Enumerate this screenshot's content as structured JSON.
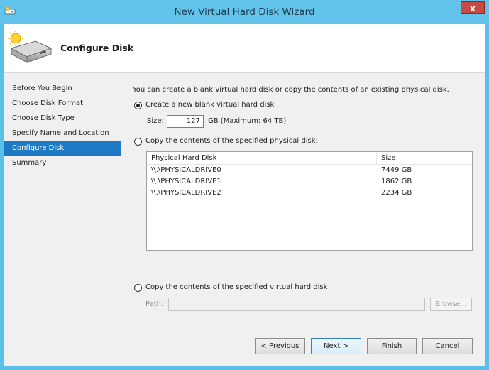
{
  "window": {
    "title": "New Virtual Hard Disk Wizard",
    "close_glyph": "x"
  },
  "header": {
    "heading": "Configure Disk"
  },
  "steps": [
    {
      "label": "Before You Begin"
    },
    {
      "label": "Choose Disk Format"
    },
    {
      "label": "Choose Disk Type"
    },
    {
      "label": "Specify Name and Location"
    },
    {
      "label": "Configure Disk",
      "active": true
    },
    {
      "label": "Summary"
    }
  ],
  "content": {
    "intro": "You can create a blank virtual hard disk or copy the contents of an existing physical disk.",
    "option_new": {
      "label": "Create a new blank virtual hard disk",
      "checked": true
    },
    "size": {
      "label": "Size:",
      "value": "127",
      "unit_note": "GB (Maximum: 64 TB)"
    },
    "option_physical": {
      "label": "Copy the contents of the specified physical disk:",
      "checked": false
    },
    "disk_table": {
      "headers": [
        "Physical Hard Disk",
        "Size"
      ],
      "rows": [
        {
          "disk": "\\\\.\\PHYSICALDRIVE0",
          "size": "7449 GB"
        },
        {
          "disk": "\\\\.\\PHYSICALDRIVE1",
          "size": "1862 GB"
        },
        {
          "disk": "\\\\.\\PHYSICALDRIVE2",
          "size": "2234 GB"
        }
      ]
    },
    "option_vhd": {
      "label": "Copy the contents of the specified virtual hard disk",
      "checked": false
    },
    "path": {
      "label": "Path:",
      "value": ""
    },
    "browse_label": "Browse..."
  },
  "footer": {
    "previous_label": "< Previous",
    "next_label": "Next >",
    "finish_label": "Finish",
    "cancel_label": "Cancel"
  }
}
